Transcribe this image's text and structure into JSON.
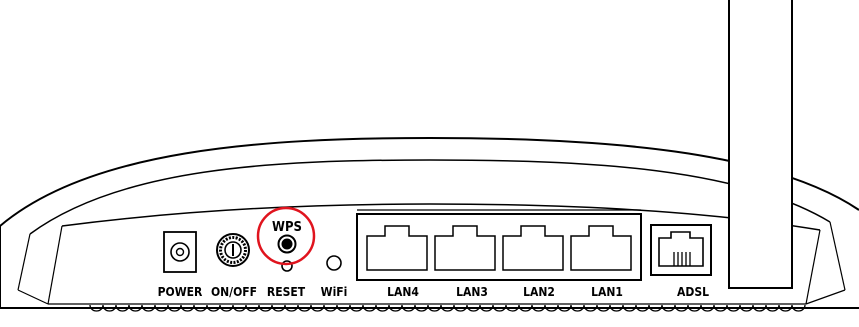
{
  "diagram": {
    "ports": {
      "power": "POWER",
      "on_off": "ON/OFF",
      "reset": "RESET",
      "wifi": "WiFi",
      "lan4": "LAN4",
      "lan3": "LAN3",
      "lan2": "LAN2",
      "lan1": "LAN1",
      "adsl": "ADSL"
    },
    "wps": "WPS",
    "highlight_color": "#e0141e"
  }
}
